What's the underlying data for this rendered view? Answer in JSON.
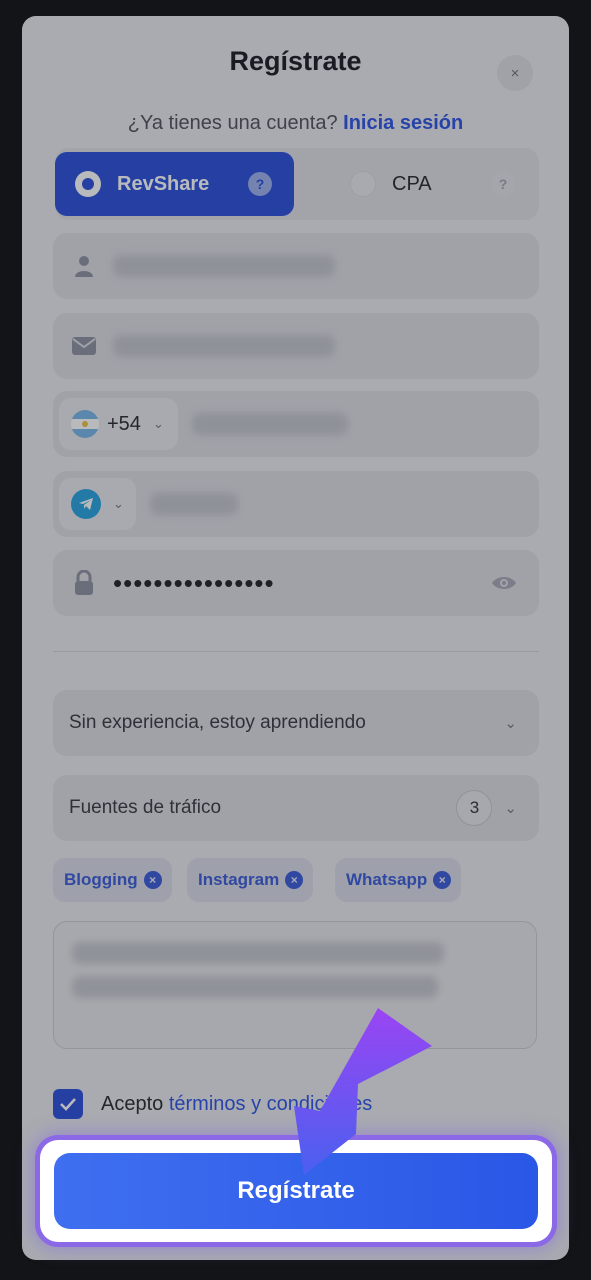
{
  "modal": {
    "title": "Regístrate",
    "close_label": "×",
    "subtitle": "¿Ya tienes una cuenta?",
    "login_link": "Inicia sesión"
  },
  "model_selector": {
    "options": [
      {
        "label": "RevShare",
        "selected": true,
        "help": "?"
      },
      {
        "label": "CPA",
        "selected": false,
        "help": "?"
      }
    ]
  },
  "form": {
    "username": {
      "icon": "user-icon",
      "value": ""
    },
    "email": {
      "icon": "mail-icon",
      "value": ""
    },
    "phone": {
      "country_flag": "argentina-flag-icon",
      "dial_code": "+54",
      "value": ""
    },
    "messenger": {
      "icon": "telegram-icon",
      "value": ""
    },
    "password": {
      "icon": "lock-icon",
      "masked_value": "••••••••••••••••",
      "toggle_icon": "eye-icon"
    },
    "experience": {
      "value": "Sin experiencia, estoy aprendiendo"
    },
    "traffic_sources": {
      "label": "Fuentes de tráfico",
      "count": "3",
      "tags": [
        "Blogging",
        "Instagram",
        "Whatsapp"
      ]
    },
    "comments": {
      "value": ""
    }
  },
  "terms": {
    "checked": true,
    "prefix": "Acepto",
    "link": "términos y condiciones"
  },
  "submit_label": "Regístrate",
  "colors": {
    "accent": "#2b4fdb",
    "link": "#2f55e4",
    "highlight_arrow": "#7a4cf0"
  }
}
